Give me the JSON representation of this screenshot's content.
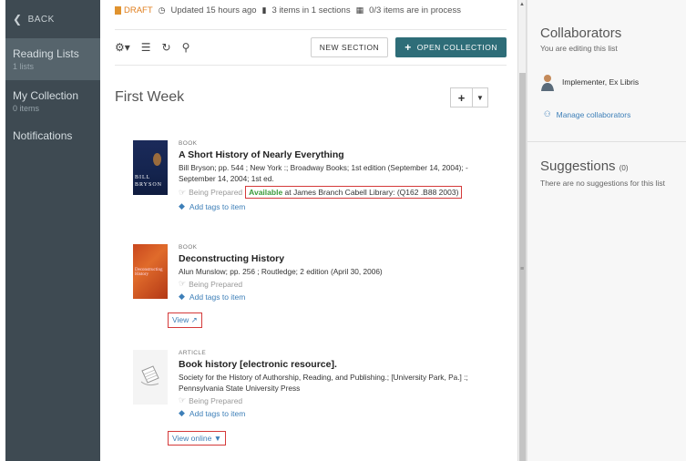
{
  "sidebar": {
    "back_label": "BACK",
    "items": [
      {
        "label": "Reading Lists",
        "sub": "1 lists"
      },
      {
        "label": "My Collection",
        "sub": "0 items"
      },
      {
        "label": "Notifications",
        "sub": ""
      }
    ]
  },
  "status": {
    "draft": "DRAFT",
    "updated": "Updated 15 hours ago",
    "items_sections": "3 items in 1 sections",
    "in_process": "0/3 items are in process"
  },
  "toolbar": {
    "new_section": "NEW SECTION",
    "open_collection": "OPEN COLLECTION"
  },
  "section": {
    "title": "First Week"
  },
  "items": [
    {
      "type": "BOOK",
      "title": "A Short History of Nearly Everything",
      "meta_line1": "Bill Bryson; pp. 544 ; New York :; Broadway Books; 1st edition (September 14, 2004); -",
      "meta_line2": "September 14, 2004; 1st ed.",
      "status": "Being Prepared",
      "availability_word": "Available",
      "availability_rest": " at James Branch Cabell Library: (Q162 .B88 2003)",
      "tags": "Add tags to item",
      "cover_line1": "BILL",
      "cover_line2": "BRYSON"
    },
    {
      "type": "BOOK",
      "title": "Deconstructing History",
      "meta_line1": "Alun Munslow; pp. 256 ; Routledge; 2 edition (April 30, 2006)",
      "status": "Being Prepared",
      "tags": "Add tags to item",
      "link": "View",
      "cover_text": "Deconstructing History"
    },
    {
      "type": "ARTICLE",
      "title": "Book history [electronic resource].",
      "meta_line1": "Society for the History of Authorship, Reading, and Publishing.; [University Park, Pa.] :;",
      "meta_line2": "Pennsylvania State University Press",
      "status": "Being Prepared",
      "tags": "Add tags to item",
      "link": "View online"
    }
  ],
  "right": {
    "collaborators_title": "Collaborators",
    "editing_note": "You are editing this list",
    "user_name": "Implementer, Ex Libris",
    "manage_label": "Manage collaborators",
    "suggestions_title": "Suggestions",
    "suggestions_count": "(0)",
    "no_suggestions": "There are no suggestions for this list"
  },
  "colors": {
    "sidebar_bg": "#3e4a52",
    "sidebar_active": "#56646c",
    "primary_button": "#2e6d78",
    "link": "#3d7fb8",
    "available": "#3a9a3a",
    "draft": "#e07f1f",
    "highlight_box": "#d43a3a"
  }
}
